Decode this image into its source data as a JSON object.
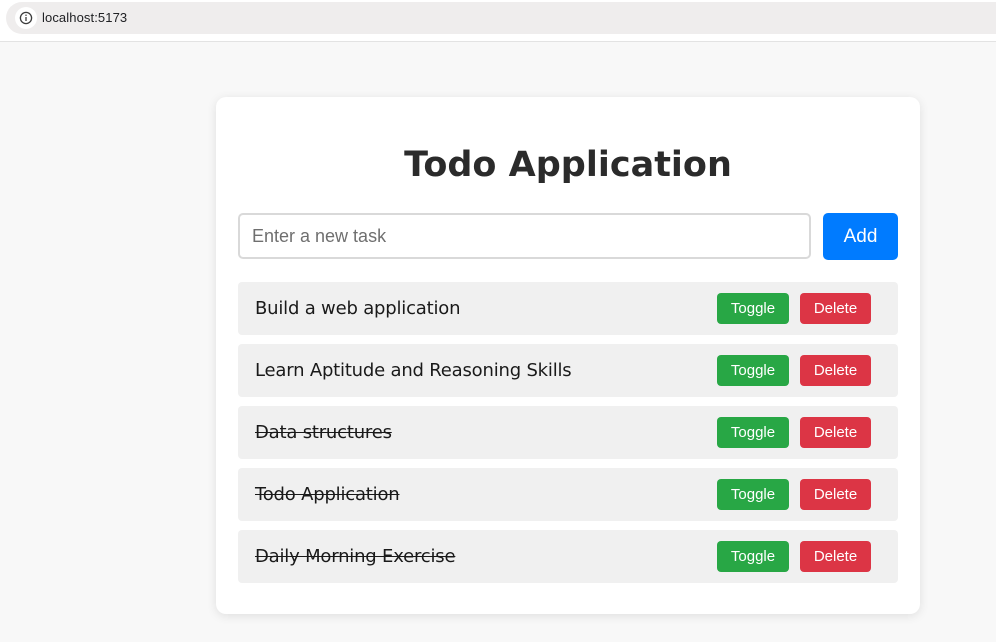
{
  "browser": {
    "url": "localhost:5173",
    "info_icon": "info-icon"
  },
  "app": {
    "title": "Todo Application",
    "input": {
      "placeholder": "Enter a new task",
      "value": ""
    },
    "add_label": "Add",
    "toggle_label": "Toggle",
    "delete_label": "Delete",
    "todos": [
      {
        "text": "Build a web application",
        "completed": false
      },
      {
        "text": "Learn Aptitude and Reasoning Skills",
        "completed": false
      },
      {
        "text": "Data structures",
        "completed": true
      },
      {
        "text": "Todo Application",
        "completed": true
      },
      {
        "text": "Daily Morning Exercise",
        "completed": true
      }
    ]
  },
  "colors": {
    "add": "#007bff",
    "toggle": "#28a745",
    "delete": "#dc3545",
    "item_bg": "#f0f0f0",
    "page_bg": "#f8f8f8"
  }
}
